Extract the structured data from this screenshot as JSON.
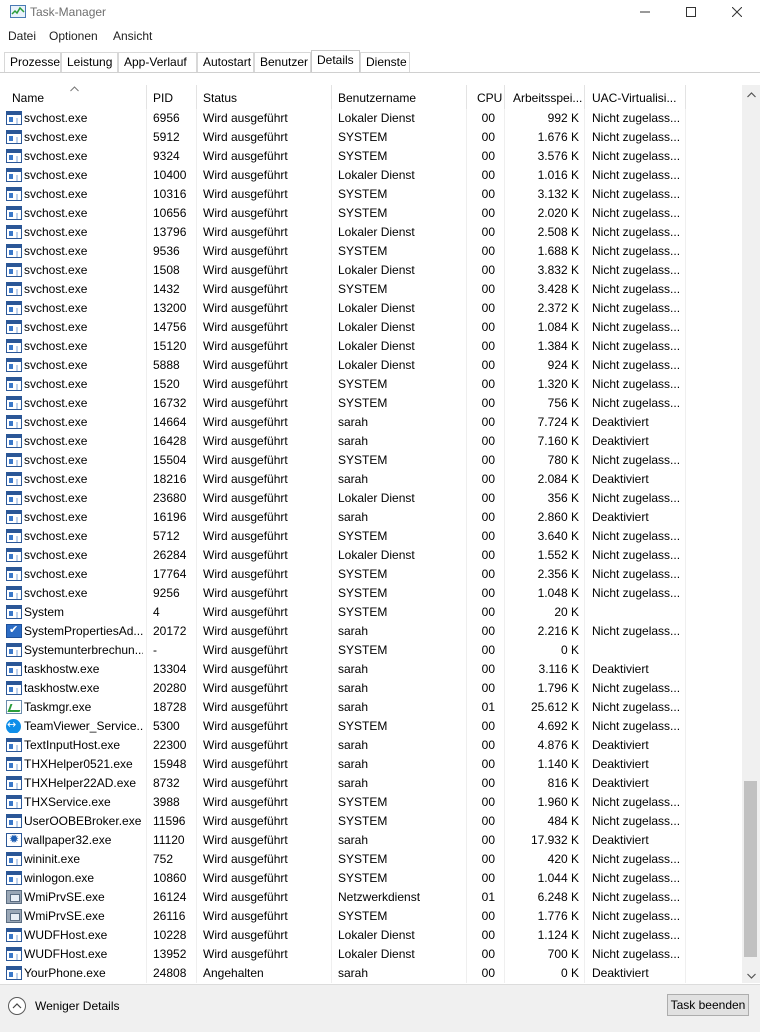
{
  "window": {
    "title": "Task-Manager",
    "app_icon": "task-manager-icon",
    "buttons": {
      "minimize": "minimize-icon",
      "maximize": "maximize-icon",
      "close": "close-icon"
    }
  },
  "menu": {
    "items": [
      "Datei",
      "Optionen",
      "Ansicht"
    ]
  },
  "tabs": {
    "items": [
      "Prozesse",
      "Leistung",
      "App-Verlauf",
      "Autostart",
      "Benutzer",
      "Details",
      "Dienste"
    ],
    "active": "Details"
  },
  "table": {
    "columns": [
      "Name",
      "PID",
      "Status",
      "Benutzername",
      "CPU",
      "Arbeitsspei...",
      "UAC-Virtualisi..."
    ],
    "sorted_column": "Name",
    "rows": [
      {
        "icon": "win",
        "name": "svchost.exe",
        "pid": "6956",
        "status": "Wird ausgeführt",
        "user": "Lokaler Dienst",
        "cpu": "00",
        "mem": "992 K",
        "uac": "Nicht zugelass..."
      },
      {
        "icon": "win",
        "name": "svchost.exe",
        "pid": "5912",
        "status": "Wird ausgeführt",
        "user": "SYSTEM",
        "cpu": "00",
        "mem": "1.676 K",
        "uac": "Nicht zugelass..."
      },
      {
        "icon": "win",
        "name": "svchost.exe",
        "pid": "9324",
        "status": "Wird ausgeführt",
        "user": "SYSTEM",
        "cpu": "00",
        "mem": "3.576 K",
        "uac": "Nicht zugelass..."
      },
      {
        "icon": "win",
        "name": "svchost.exe",
        "pid": "10400",
        "status": "Wird ausgeführt",
        "user": "Lokaler Dienst",
        "cpu": "00",
        "mem": "1.016 K",
        "uac": "Nicht zugelass..."
      },
      {
        "icon": "win",
        "name": "svchost.exe",
        "pid": "10316",
        "status": "Wird ausgeführt",
        "user": "SYSTEM",
        "cpu": "00",
        "mem": "3.132 K",
        "uac": "Nicht zugelass..."
      },
      {
        "icon": "win",
        "name": "svchost.exe",
        "pid": "10656",
        "status": "Wird ausgeführt",
        "user": "SYSTEM",
        "cpu": "00",
        "mem": "2.020 K",
        "uac": "Nicht zugelass..."
      },
      {
        "icon": "win",
        "name": "svchost.exe",
        "pid": "13796",
        "status": "Wird ausgeführt",
        "user": "Lokaler Dienst",
        "cpu": "00",
        "mem": "2.508 K",
        "uac": "Nicht zugelass..."
      },
      {
        "icon": "win",
        "name": "svchost.exe",
        "pid": "9536",
        "status": "Wird ausgeführt",
        "user": "SYSTEM",
        "cpu": "00",
        "mem": "1.688 K",
        "uac": "Nicht zugelass..."
      },
      {
        "icon": "win",
        "name": "svchost.exe",
        "pid": "1508",
        "status": "Wird ausgeführt",
        "user": "Lokaler Dienst",
        "cpu": "00",
        "mem": "3.832 K",
        "uac": "Nicht zugelass..."
      },
      {
        "icon": "win",
        "name": "svchost.exe",
        "pid": "1432",
        "status": "Wird ausgeführt",
        "user": "SYSTEM",
        "cpu": "00",
        "mem": "3.428 K",
        "uac": "Nicht zugelass..."
      },
      {
        "icon": "win",
        "name": "svchost.exe",
        "pid": "13200",
        "status": "Wird ausgeführt",
        "user": "Lokaler Dienst",
        "cpu": "00",
        "mem": "2.372 K",
        "uac": "Nicht zugelass..."
      },
      {
        "icon": "win",
        "name": "svchost.exe",
        "pid": "14756",
        "status": "Wird ausgeführt",
        "user": "Lokaler Dienst",
        "cpu": "00",
        "mem": "1.084 K",
        "uac": "Nicht zugelass..."
      },
      {
        "icon": "win",
        "name": "svchost.exe",
        "pid": "15120",
        "status": "Wird ausgeführt",
        "user": "Lokaler Dienst",
        "cpu": "00",
        "mem": "1.384 K",
        "uac": "Nicht zugelass..."
      },
      {
        "icon": "win",
        "name": "svchost.exe",
        "pid": "5888",
        "status": "Wird ausgeführt",
        "user": "Lokaler Dienst",
        "cpu": "00",
        "mem": "924 K",
        "uac": "Nicht zugelass..."
      },
      {
        "icon": "win",
        "name": "svchost.exe",
        "pid": "1520",
        "status": "Wird ausgeführt",
        "user": "SYSTEM",
        "cpu": "00",
        "mem": "1.320 K",
        "uac": "Nicht zugelass..."
      },
      {
        "icon": "win",
        "name": "svchost.exe",
        "pid": "16732",
        "status": "Wird ausgeführt",
        "user": "SYSTEM",
        "cpu": "00",
        "mem": "756 K",
        "uac": "Nicht zugelass..."
      },
      {
        "icon": "win",
        "name": "svchost.exe",
        "pid": "14664",
        "status": "Wird ausgeführt",
        "user": "sarah",
        "cpu": "00",
        "mem": "7.724 K",
        "uac": "Deaktiviert"
      },
      {
        "icon": "win",
        "name": "svchost.exe",
        "pid": "16428",
        "status": "Wird ausgeführt",
        "user": "sarah",
        "cpu": "00",
        "mem": "7.160 K",
        "uac": "Deaktiviert"
      },
      {
        "icon": "win",
        "name": "svchost.exe",
        "pid": "15504",
        "status": "Wird ausgeführt",
        "user": "SYSTEM",
        "cpu": "00",
        "mem": "780 K",
        "uac": "Nicht zugelass..."
      },
      {
        "icon": "win",
        "name": "svchost.exe",
        "pid": "18216",
        "status": "Wird ausgeführt",
        "user": "sarah",
        "cpu": "00",
        "mem": "2.084 K",
        "uac": "Deaktiviert"
      },
      {
        "icon": "win",
        "name": "svchost.exe",
        "pid": "23680",
        "status": "Wird ausgeführt",
        "user": "Lokaler Dienst",
        "cpu": "00",
        "mem": "356 K",
        "uac": "Nicht zugelass..."
      },
      {
        "icon": "win",
        "name": "svchost.exe",
        "pid": "16196",
        "status": "Wird ausgeführt",
        "user": "sarah",
        "cpu": "00",
        "mem": "2.860 K",
        "uac": "Deaktiviert"
      },
      {
        "icon": "win",
        "name": "svchost.exe",
        "pid": "5712",
        "status": "Wird ausgeführt",
        "user": "SYSTEM",
        "cpu": "00",
        "mem": "3.640 K",
        "uac": "Nicht zugelass..."
      },
      {
        "icon": "win",
        "name": "svchost.exe",
        "pid": "26284",
        "status": "Wird ausgeführt",
        "user": "Lokaler Dienst",
        "cpu": "00",
        "mem": "1.552 K",
        "uac": "Nicht zugelass..."
      },
      {
        "icon": "win",
        "name": "svchost.exe",
        "pid": "17764",
        "status": "Wird ausgeführt",
        "user": "SYSTEM",
        "cpu": "00",
        "mem": "2.356 K",
        "uac": "Nicht zugelass..."
      },
      {
        "icon": "win",
        "name": "svchost.exe",
        "pid": "9256",
        "status": "Wird ausgeführt",
        "user": "SYSTEM",
        "cpu": "00",
        "mem": "1.048 K",
        "uac": "Nicht zugelass..."
      },
      {
        "icon": "win",
        "name": "System",
        "pid": "4",
        "status": "Wird ausgeführt",
        "user": "SYSTEM",
        "cpu": "00",
        "mem": "20 K",
        "uac": ""
      },
      {
        "icon": "sysprop",
        "name": "SystemPropertiesAd...",
        "pid": "20172",
        "status": "Wird ausgeführt",
        "user": "sarah",
        "cpu": "00",
        "mem": "2.216 K",
        "uac": "Nicht zugelass..."
      },
      {
        "icon": "win",
        "name": "Systemunterbrechun...",
        "pid": "-",
        "status": "Wird ausgeführt",
        "user": "SYSTEM",
        "cpu": "00",
        "mem": "0 K",
        "uac": ""
      },
      {
        "icon": "win",
        "name": "taskhostw.exe",
        "pid": "13304",
        "status": "Wird ausgeführt",
        "user": "sarah",
        "cpu": "00",
        "mem": "3.116 K",
        "uac": "Deaktiviert"
      },
      {
        "icon": "win",
        "name": "taskhostw.exe",
        "pid": "20280",
        "status": "Wird ausgeführt",
        "user": "sarah",
        "cpu": "00",
        "mem": "1.796 K",
        "uac": "Nicht zugelass..."
      },
      {
        "icon": "mgr",
        "name": "Taskmgr.exe",
        "pid": "18728",
        "status": "Wird ausgeführt",
        "user": "sarah",
        "cpu": "01",
        "mem": "25.612 K",
        "uac": "Nicht zugelass..."
      },
      {
        "icon": "tv",
        "name": "TeamViewer_Service....",
        "pid": "5300",
        "status": "Wird ausgeführt",
        "user": "SYSTEM",
        "cpu": "00",
        "mem": "4.692 K",
        "uac": "Nicht zugelass..."
      },
      {
        "icon": "win",
        "name": "TextInputHost.exe",
        "pid": "22300",
        "status": "Wird ausgeführt",
        "user": "sarah",
        "cpu": "00",
        "mem": "4.876 K",
        "uac": "Deaktiviert"
      },
      {
        "icon": "win",
        "name": "THXHelper0521.exe",
        "pid": "15948",
        "status": "Wird ausgeführt",
        "user": "sarah",
        "cpu": "00",
        "mem": "1.140 K",
        "uac": "Deaktiviert"
      },
      {
        "icon": "win",
        "name": "THXHelper22AD.exe",
        "pid": "8732",
        "status": "Wird ausgeführt",
        "user": "sarah",
        "cpu": "00",
        "mem": "816 K",
        "uac": "Deaktiviert"
      },
      {
        "icon": "win",
        "name": "THXService.exe",
        "pid": "3988",
        "status": "Wird ausgeführt",
        "user": "SYSTEM",
        "cpu": "00",
        "mem": "1.960 K",
        "uac": "Nicht zugelass..."
      },
      {
        "icon": "win",
        "name": "UserOOBEBroker.exe",
        "pid": "11596",
        "status": "Wird ausgeführt",
        "user": "SYSTEM",
        "cpu": "00",
        "mem": "484 K",
        "uac": "Nicht zugelass..."
      },
      {
        "icon": "gear",
        "name": "wallpaper32.exe",
        "pid": "11120",
        "status": "Wird ausgeführt",
        "user": "sarah",
        "cpu": "00",
        "mem": "17.932 K",
        "uac": "Deaktiviert"
      },
      {
        "icon": "win",
        "name": "wininit.exe",
        "pid": "752",
        "status": "Wird ausgeführt",
        "user": "SYSTEM",
        "cpu": "00",
        "mem": "420 K",
        "uac": "Nicht zugelass..."
      },
      {
        "icon": "win",
        "name": "winlogon.exe",
        "pid": "10860",
        "status": "Wird ausgeführt",
        "user": "SYSTEM",
        "cpu": "00",
        "mem": "1.044 K",
        "uac": "Nicht zugelass..."
      },
      {
        "icon": "wmi",
        "name": "WmiPrvSE.exe",
        "pid": "16124",
        "status": "Wird ausgeführt",
        "user": "Netzwerkdienst",
        "cpu": "01",
        "mem": "6.248 K",
        "uac": "Nicht zugelass..."
      },
      {
        "icon": "wmi",
        "name": "WmiPrvSE.exe",
        "pid": "26116",
        "status": "Wird ausgeführt",
        "user": "SYSTEM",
        "cpu": "00",
        "mem": "1.776 K",
        "uac": "Nicht zugelass..."
      },
      {
        "icon": "win",
        "name": "WUDFHost.exe",
        "pid": "10228",
        "status": "Wird ausgeführt",
        "user": "Lokaler Dienst",
        "cpu": "00",
        "mem": "1.124 K",
        "uac": "Nicht zugelass..."
      },
      {
        "icon": "win",
        "name": "WUDFHost.exe",
        "pid": "13952",
        "status": "Wird ausgeführt",
        "user": "Lokaler Dienst",
        "cpu": "00",
        "mem": "700 K",
        "uac": "Nicht zugelass..."
      },
      {
        "icon": "win",
        "name": "YourPhone.exe",
        "pid": "24808",
        "status": "Angehalten",
        "user": "sarah",
        "cpu": "00",
        "mem": "0 K",
        "uac": "Deaktiviert"
      }
    ]
  },
  "footer": {
    "less_details_label": "Weniger Details",
    "end_task_label": "Task beenden"
  }
}
